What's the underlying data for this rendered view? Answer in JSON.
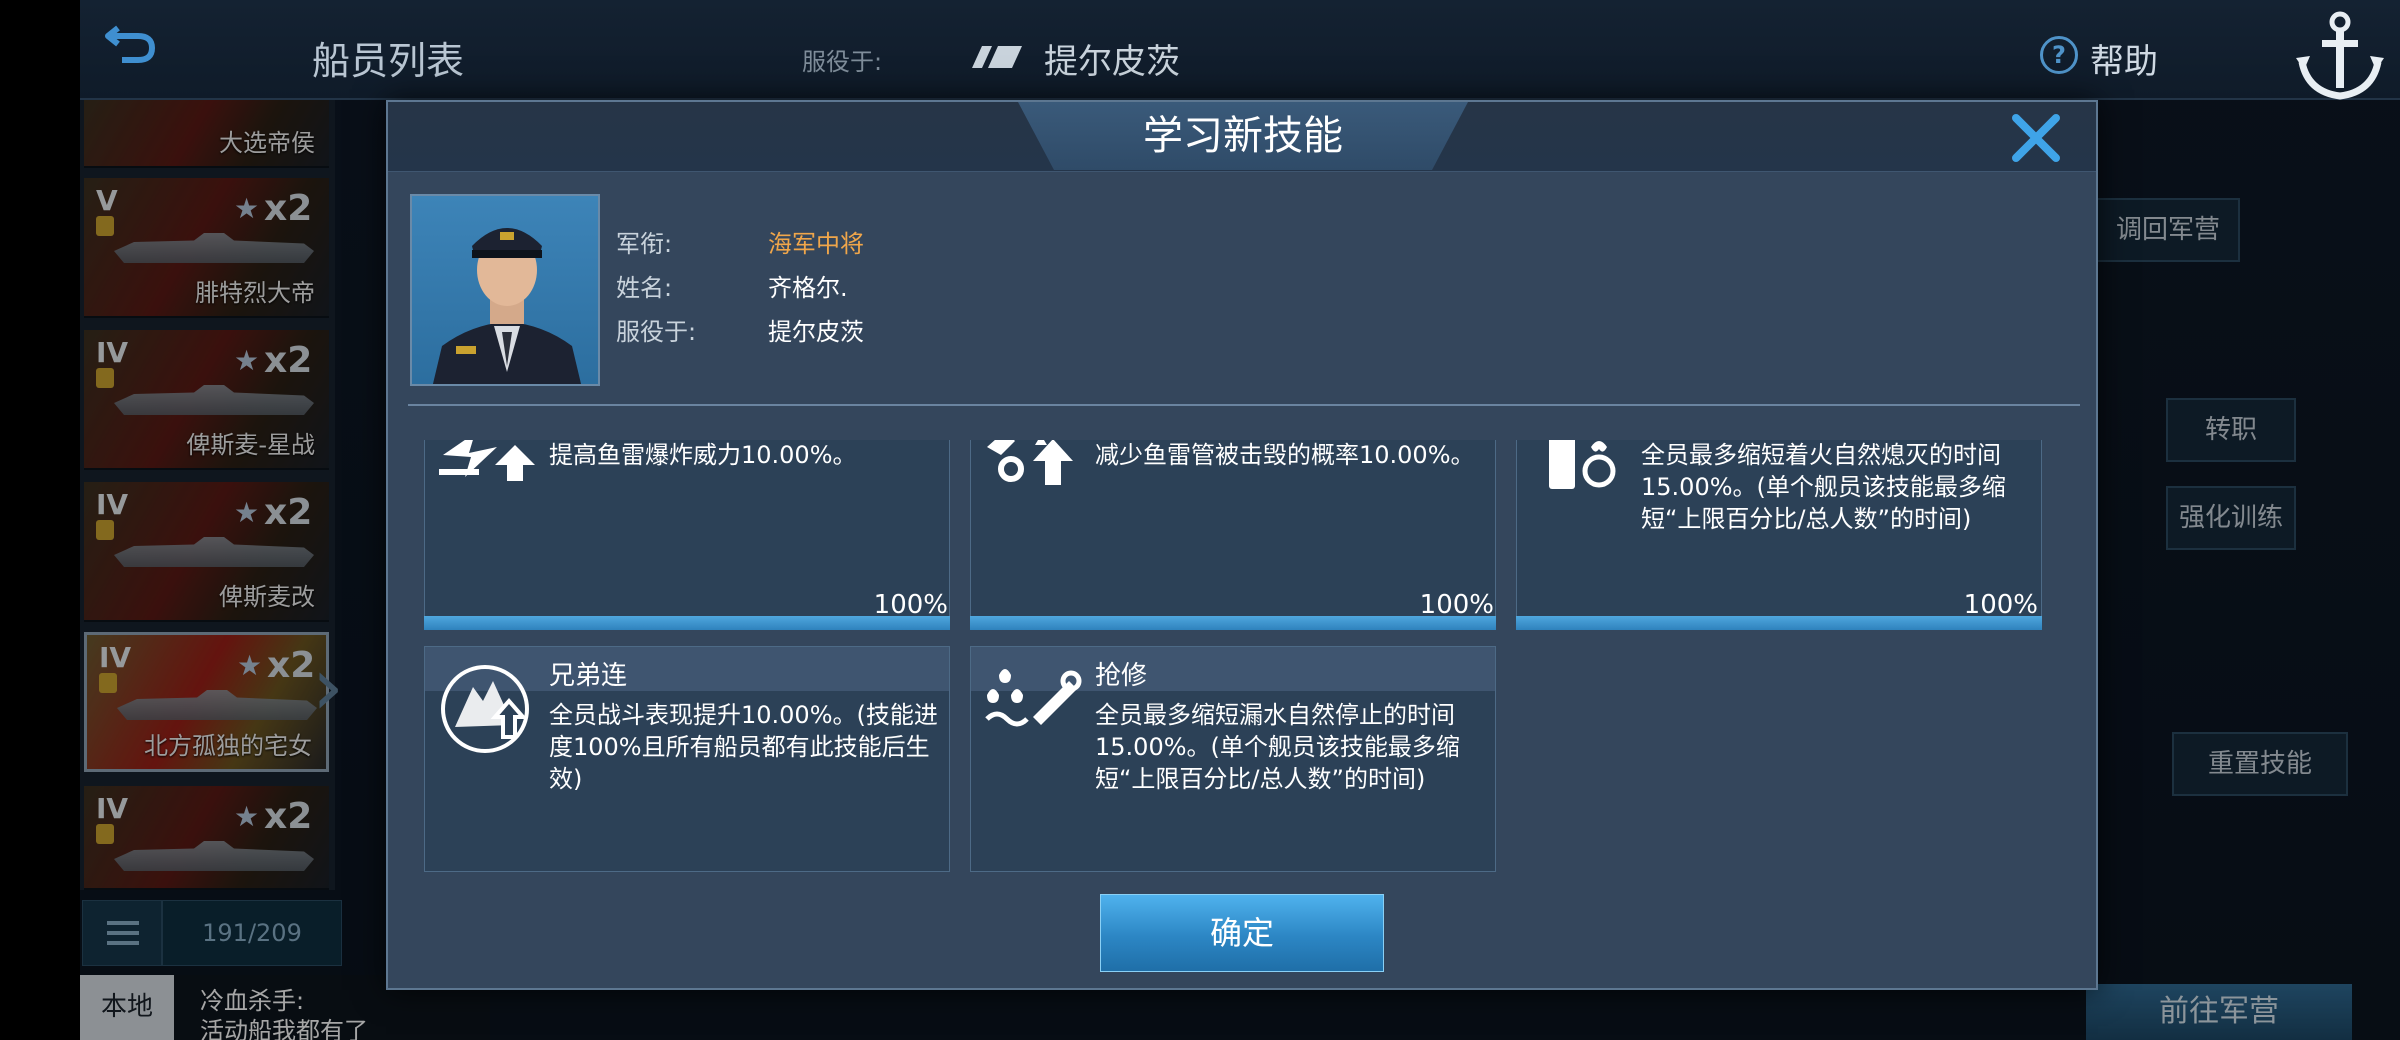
{
  "header": {
    "crew_list_title": "船员列表",
    "serve_label": "服役于:",
    "serve_ship": "提尔皮茨",
    "help_label": "帮助"
  },
  "crew_list": [
    {
      "tier": "",
      "multiplier": "",
      "name": "大选帝侯"
    },
    {
      "tier": "V",
      "multiplier": "x2",
      "name": "腓特烈大帝"
    },
    {
      "tier": "IV",
      "multiplier": "x2",
      "name": "俾斯麦-星战"
    },
    {
      "tier": "IV",
      "multiplier": "x2",
      "name": "俾斯麦改"
    },
    {
      "tier": "IV",
      "multiplier": "x2",
      "name": "北方孤独的宅女",
      "selected": true
    },
    {
      "tier": "IV",
      "multiplier": "x2",
      "name": ""
    }
  ],
  "crew_count": "191/209",
  "chat": {
    "tab": "本地",
    "sender": "冷血杀手:",
    "message": "活动船我都有了"
  },
  "right_panel": {
    "buttons": [
      "调回军营",
      "转职",
      "强化训练",
      "重置技能"
    ],
    "goto_button": "前往军营"
  },
  "modal": {
    "title": "学习新技能",
    "close_icon": "close-icon",
    "officer": {
      "rank_label": "军衔:",
      "rank_value": "海军中将",
      "name_label": "姓名:",
      "name_value": "齐格尔.",
      "serve_label": "服役于:",
      "serve_value": "提尔皮茨"
    },
    "skills": [
      {
        "name": "",
        "desc": "提高鱼雷爆炸威力10.00%。",
        "progress_pct": "100%",
        "progress": 1.0,
        "icon": "torpedo-power-icon"
      },
      {
        "name": "",
        "desc": "减少鱼雷管被击毁的概率10.00%。",
        "progress_pct": "100%",
        "progress": 1.0,
        "icon": "torpedo-tube-repair-icon"
      },
      {
        "name": "",
        "desc": "全员最多缩短着火自然熄灭的时间15.00%。(单个舰员该技能最多缩短“上限百分比/总人数”的时间)",
        "progress_pct": "100%",
        "progress": 1.0,
        "icon": "fire-extinguisher-icon"
      },
      {
        "name": "兄弟连",
        "desc": "全员战斗表现提升10.00%。(技能进度100%且所有船员都有此技能后生效)",
        "icon": "brotherhood-icon"
      },
      {
        "name": "抢修",
        "desc": "全员最多缩短漏水自然停止的时间15.00%。(单个舰员该技能最多缩短“上限百分比/总人数”的时间)",
        "icon": "flood-repair-icon"
      }
    ],
    "confirm": "确定"
  },
  "colors": {
    "rank_gold": "#f0a64a",
    "progress_blue": "#3a96d2",
    "confirm_blue": "#3a9ad8",
    "close_blue": "#3fa4e8"
  }
}
